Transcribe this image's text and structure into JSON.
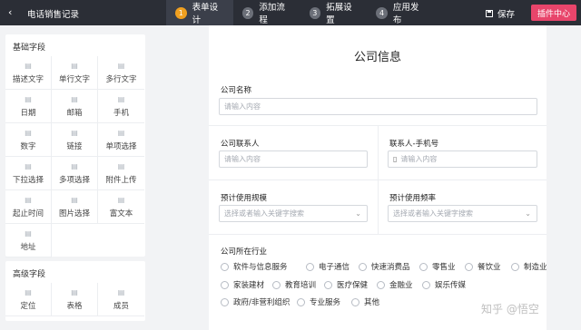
{
  "header": {
    "back_icon": "back-arrow-icon",
    "title": "电话销售记录",
    "steps": [
      {
        "num": "1",
        "label": "表单设计"
      },
      {
        "num": "2",
        "label": "添加流程"
      },
      {
        "num": "3",
        "label": "拓展设置"
      },
      {
        "num": "4",
        "label": "应用发布"
      }
    ],
    "save_label": "保存",
    "plugin_label": "插件中心",
    "accent_color": "#f0a020",
    "plugin_color": "#e8456b"
  },
  "sidebar": {
    "basic_title": "基础字段",
    "basic_fields": [
      {
        "label": "描述文字",
        "icon": "text-icon"
      },
      {
        "label": "单行文字",
        "icon": "single-line-icon"
      },
      {
        "label": "多行文字",
        "icon": "multi-line-icon"
      },
      {
        "label": "日期",
        "icon": "calendar-icon"
      },
      {
        "label": "邮箱",
        "icon": "mail-icon"
      },
      {
        "label": "手机",
        "icon": "phone-icon"
      },
      {
        "label": "数字",
        "icon": "number-icon"
      },
      {
        "label": "链接",
        "icon": "link-icon"
      },
      {
        "label": "单项选择",
        "icon": "radio-icon"
      },
      {
        "label": "下拉选择",
        "icon": "dropdown-icon"
      },
      {
        "label": "多项选择",
        "icon": "checkbox-icon"
      },
      {
        "label": "附件上传",
        "icon": "attachment-icon"
      },
      {
        "label": "起止时间",
        "icon": "time-range-icon"
      },
      {
        "label": "图片选择",
        "icon": "image-icon"
      },
      {
        "label": "富文本",
        "icon": "rich-text-icon"
      },
      {
        "label": "地址",
        "icon": "location-icon"
      }
    ],
    "advanced_title": "高级字段",
    "advanced_fields": [
      {
        "label": "定位",
        "icon": "map-pin-icon"
      },
      {
        "label": "表格",
        "icon": "table-icon"
      },
      {
        "label": "成员",
        "icon": "member-icon"
      }
    ]
  },
  "form": {
    "title": "公司信息",
    "company_name": {
      "label": "公司名称",
      "placeholder": "请输入内容"
    },
    "contact": {
      "label": "公司联系人",
      "placeholder": "请输入内容"
    },
    "contact_phone": {
      "label": "联系人-手机号",
      "placeholder": "请输入内容"
    },
    "scale": {
      "label": "预计使用规模",
      "placeholder": "选择或者输入关键字搜索"
    },
    "frequency": {
      "label": "预计使用频率",
      "placeholder": "选择或者输入关键字搜索"
    },
    "industry": {
      "label": "公司所在行业",
      "options": [
        "软件与信息服务",
        "电子通信",
        "快速消费品",
        "零售业",
        "餐饮业",
        "制造业",
        "家装建材",
        "教育培训",
        "医疗保健",
        "金融业",
        "娱乐传媒",
        "政府/非营利组织",
        "专业服务",
        "其他"
      ]
    }
  },
  "watermark": "知乎 @悟空"
}
